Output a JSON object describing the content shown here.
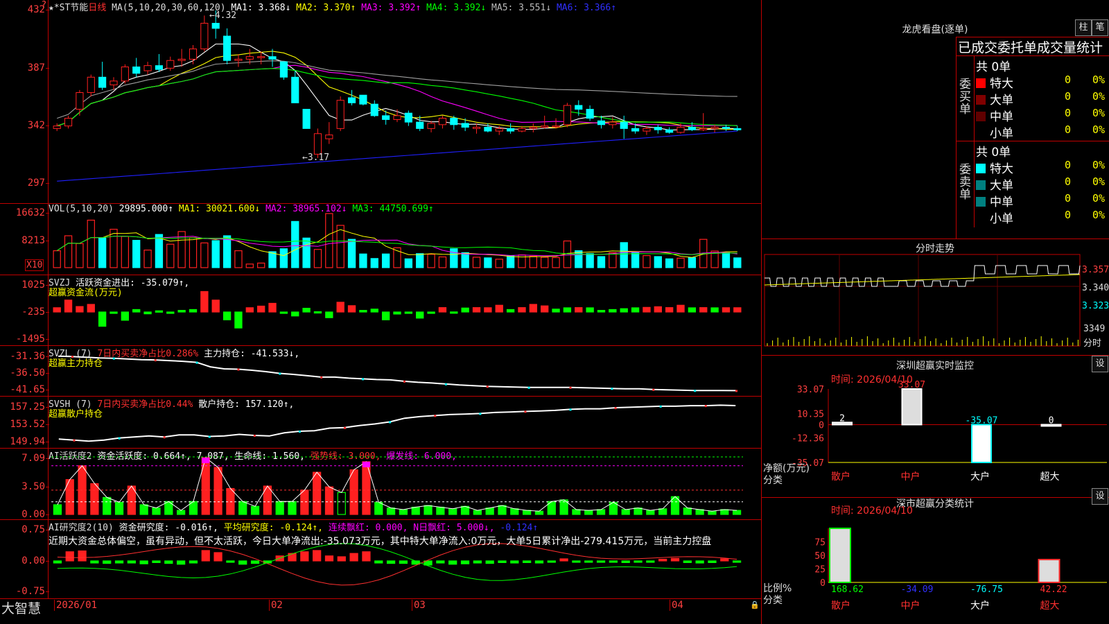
{
  "colors": {
    "up": "#ff2020",
    "down": "#00ffff",
    "bg": "#000000",
    "grid": "#c00000",
    "ma1": "#ffffff",
    "ma2": "#ffff00",
    "ma3": "#ff00ff",
    "ma4": "#00ff00",
    "ma5": "#a0a0a0",
    "ma6": "#2020ff"
  },
  "main": {
    "stock": "★*ST节能",
    "period": "日线",
    "ma_label": "MA(5,10,20,30,60,120)",
    "ma1": "MA1: 3.368↓",
    "ma2": "MA2: 3.370↑",
    "ma3": "MA3: 3.392↑",
    "ma4": "MA4: 3.392↓",
    "ma5": "MA5: 3.551↓",
    "ma6": "MA6: 3.366↑",
    "high_label": "←4.32",
    "low_label": "←3.17",
    "ticks": [
      "432",
      "387",
      "342",
      "297"
    ],
    "corner": "?"
  },
  "vol": {
    "label": "VOL(5,10,20)",
    "value": "29895.000↑",
    "ma1": "MA1: 30021.600↓",
    "ma2": "MA2: 38965.102↓",
    "ma3": "MA3: 44750.699↑",
    "ticks": [
      "16632",
      "8213"
    ],
    "unit": "X10"
  },
  "svzj": {
    "label": "SVZJ",
    "title": "活跃资金进出: -35.079↑,",
    "sub": "超赢资金流(万元)",
    "ticks": [
      "1025",
      "-235",
      "-1495"
    ]
  },
  "svzl": {
    "label": "SVZL (7)",
    "title": "7日内买卖净占比0.286%",
    "value": "主力持仓: -41.533↓,",
    "sub": "超赢主力持仓",
    "ticks": [
      "-31.36",
      "-36.50",
      "-41.65"
    ]
  },
  "svsh": {
    "label": "SVSH (7)",
    "title": "7日内买卖净占比0.44%",
    "value": "散户持仓: 157.120↑,",
    "sub": "超赢散户持仓",
    "ticks": [
      "157.25",
      "153.52",
      "149.94"
    ]
  },
  "ai1": {
    "label": "AI活跃度2",
    "v1": "资金活跃度: 0.664↑, 7.087,",
    "v2": "生命线: 1.560,",
    "v3": "强势线: 3.000,",
    "v4": "爆发线: 6.000,",
    "ticks": [
      "7.09",
      "3.50",
      "0.00"
    ]
  },
  "ai2": {
    "label": "AI研究度2(10)",
    "v1": "资金研究度: -0.016↑,",
    "v2": "平均研究度: -0.124↑,",
    "v3": "连续飘红: 0.000,",
    "v4": "N日飘红: 5.000↓,",
    "v5": "-0.124↑",
    "comment": "近期大资金总体偏空，虽有异动，但不太活跃，今日大单净流出:-35.073万元，其中特大单净流入:0万元，大单5日累计净出-279.415万元，当前主力控盘",
    "ticks": [
      "0.75",
      "0.00",
      "-0.75"
    ]
  },
  "xaxis": {
    "labels": [
      "2026/01",
      "02",
      "03",
      "04"
    ],
    "brand": "大智慧"
  },
  "lhb": {
    "title": "龙虎看盘(逐单)",
    "btn1": "柱",
    "btn2": "笔",
    "subtitle": "已成交委托单成交量统计",
    "buy": {
      "side": "委买单",
      "total": "共 0单",
      "rows": [
        {
          "name": "特大",
          "val": "0",
          "pct": "0%",
          "color": "#ff0000"
        },
        {
          "name": "大单",
          "val": "0",
          "pct": "0%",
          "color": "#800000"
        },
        {
          "name": "中单",
          "val": "0",
          "pct": "0%",
          "color": "#600000"
        },
        {
          "name": "小单",
          "val": "0",
          "pct": "0%",
          "color": "#000000"
        }
      ]
    },
    "sell": {
      "side": "委卖单",
      "total": "共 0单",
      "rows": [
        {
          "name": "特大",
          "val": "0",
          "pct": "0%",
          "color": "#00ffff"
        },
        {
          "name": "大单",
          "val": "0",
          "pct": "0%",
          "color": "#008080"
        },
        {
          "name": "中单",
          "val": "0",
          "pct": "0%",
          "color": "#008080"
        },
        {
          "name": "小单",
          "val": "0",
          "pct": "0%",
          "color": "#000000"
        }
      ]
    }
  },
  "intraday": {
    "title": "分时走势",
    "ticks": [
      "3.357",
      "3.340",
      "3.323"
    ],
    "vol_tick": "3349",
    "vol_unit": "分时"
  },
  "sz_monitor": {
    "title": "深圳超赢实时监控",
    "btn": "设",
    "time": "时间: 2026/04/10",
    "yticks": [
      "33.07",
      "10.35",
      "0",
      "-12.36",
      "-35.07"
    ],
    "ylabel": "净额(万元)",
    "xlabel": "分类",
    "categories": [
      "散户",
      "中户",
      "大户",
      "超大"
    ],
    "values": [
      2,
      33.07,
      -35.07,
      0
    ],
    "value_labels": [
      "2",
      "33.07",
      "-35.07",
      "0"
    ]
  },
  "sz_class": {
    "title": "深市超赢分类统计",
    "btn": "设",
    "time": "时间: 2026/04/10",
    "yticks": [
      "75",
      "50",
      "25",
      "0"
    ],
    "ylabel": "比例%",
    "xlabel": "分类",
    "categories": [
      "散户",
      "中户",
      "大户",
      "超大"
    ],
    "values": [
      168.62,
      -34.09,
      -76.75,
      42.22
    ],
    "value_labels": [
      "168.62",
      "-34.09",
      "-76.75",
      "42.22"
    ]
  },
  "chart_data": [
    {
      "type": "candlestick",
      "title": "★*ST节能 日线",
      "ylim": [
        2.97,
        4.32
      ],
      "high": 4.32,
      "low": 3.17,
      "ohlc": [
        [
          3.4,
          3.44,
          3.38,
          3.42
        ],
        [
          3.42,
          3.5,
          3.4,
          3.48
        ],
        [
          3.55,
          3.7,
          3.5,
          3.68
        ],
        [
          3.68,
          3.82,
          3.65,
          3.8
        ],
        [
          3.8,
          3.92,
          3.7,
          3.72
        ],
        [
          3.74,
          3.8,
          3.7,
          3.77
        ],
        [
          3.77,
          3.9,
          3.75,
          3.88
        ],
        [
          3.88,
          3.95,
          3.8,
          3.83
        ],
        [
          3.85,
          3.92,
          3.82,
          3.89
        ],
        [
          3.89,
          3.98,
          3.84,
          3.86
        ],
        [
          3.87,
          3.96,
          3.85,
          3.93
        ],
        [
          3.93,
          4.02,
          3.88,
          3.94
        ],
        [
          3.94,
          4.05,
          3.9,
          4.02
        ],
        [
          4.02,
          4.28,
          4.0,
          4.22
        ],
        [
          4.22,
          4.32,
          4.1,
          4.18
        ],
        [
          4.12,
          4.18,
          3.9,
          3.93
        ],
        [
          3.93,
          3.98,
          3.88,
          3.94
        ],
        [
          3.94,
          4.02,
          3.9,
          3.96
        ],
        [
          3.96,
          4.0,
          3.9,
          3.96
        ],
        [
          3.96,
          4.02,
          3.88,
          3.94
        ],
        [
          3.92,
          3.92,
          3.78,
          3.8
        ],
        [
          3.8,
          3.85,
          3.6,
          3.6
        ],
        [
          3.55,
          3.55,
          3.4,
          3.4
        ],
        [
          3.2,
          3.4,
          3.17,
          3.36
        ],
        [
          3.32,
          3.45,
          3.28,
          3.35
        ],
        [
          3.4,
          3.65,
          3.38,
          3.62
        ],
        [
          3.64,
          3.7,
          3.58,
          3.6
        ],
        [
          3.66,
          3.66,
          3.58,
          3.59
        ],
        [
          3.59,
          3.62,
          3.49,
          3.5
        ],
        [
          3.5,
          3.54,
          3.43,
          3.47
        ],
        [
          3.47,
          3.55,
          3.45,
          3.5
        ],
        [
          3.52,
          3.54,
          3.42,
          3.45
        ],
        [
          3.45,
          3.5,
          3.38,
          3.4
        ],
        [
          3.4,
          3.46,
          3.37,
          3.44
        ],
        [
          3.43,
          3.5,
          3.4,
          3.48
        ],
        [
          3.48,
          3.5,
          3.39,
          3.43
        ],
        [
          3.44,
          3.48,
          3.38,
          3.41
        ],
        [
          3.4,
          3.44,
          3.36,
          3.41
        ],
        [
          3.41,
          3.44,
          3.37,
          3.38
        ],
        [
          3.38,
          3.42,
          3.35,
          3.4
        ],
        [
          3.4,
          3.44,
          3.36,
          3.38
        ],
        [
          3.38,
          3.42,
          3.37,
          3.4
        ],
        [
          3.4,
          3.44,
          3.37,
          3.41
        ],
        [
          3.41,
          3.5,
          3.4,
          3.42
        ],
        [
          3.42,
          3.48,
          3.4,
          3.42
        ],
        [
          3.43,
          3.6,
          3.41,
          3.58
        ],
        [
          3.58,
          3.62,
          3.5,
          3.55
        ],
        [
          3.55,
          3.58,
          3.46,
          3.48
        ],
        [
          3.46,
          3.5,
          3.4,
          3.43
        ],
        [
          3.43,
          3.49,
          3.4,
          3.45
        ],
        [
          3.45,
          3.5,
          3.32,
          3.4
        ],
        [
          3.4,
          3.44,
          3.36,
          3.38
        ],
        [
          3.38,
          3.42,
          3.35,
          3.4
        ],
        [
          3.41,
          3.43,
          3.36,
          3.39
        ],
        [
          3.39,
          3.41,
          3.36,
          3.37
        ],
        [
          3.37,
          3.44,
          3.36,
          3.41
        ],
        [
          3.41,
          3.45,
          3.38,
          3.39
        ],
        [
          3.39,
          3.52,
          3.38,
          3.4
        ],
        [
          3.4,
          3.43,
          3.37,
          3.41
        ],
        [
          3.41,
          3.43,
          3.38,
          3.4
        ],
        [
          3.4,
          3.42,
          3.38,
          3.39
        ]
      ]
    },
    {
      "type": "bar",
      "title": "VOL(5,10,20)",
      "ylim": [
        0,
        16632
      ],
      "values": [
        5200,
        9800,
        7400,
        14600,
        9100,
        11800,
        9600,
        8400,
        5400,
        10200,
        7200,
        11100,
        9200,
        7600,
        8300,
        9800,
        5200,
        1100,
        1400,
        4900,
        5800,
        14200,
        9100,
        5600,
        16632,
        13000,
        8700,
        4200,
        2800,
        4200,
        6100,
        2700,
        4300,
        4100,
        3300,
        5800,
        4600,
        3200,
        3000,
        2600,
        3700,
        3900,
        3500,
        3200,
        3100,
        8200,
        5200,
        4300,
        3400,
        4600,
        7700,
        4800,
        3700,
        3400,
        2700,
        2900,
        3100,
        8700,
        5100,
        4600,
        3000
      ]
    },
    {
      "type": "bar",
      "title": "SVZJ 活跃资金进出",
      "ylim": [
        -1495,
        1025
      ],
      "values": [
        -35,
        320,
        20,
        120,
        -900,
        -300,
        -620,
        -120,
        -320,
        -180,
        -300,
        -160,
        -120,
        720,
        320,
        -600,
        -980,
        -35,
        40,
        170,
        -300,
        -420,
        -60,
        -220,
        -500,
        220,
        60,
        -160,
        -100,
        -600,
        -330,
        -300,
        -520,
        -300,
        -30,
        -230,
        -50,
        -30,
        -35,
        80,
        -120,
        -30,
        120,
        50,
        -100,
        -40,
        -30,
        -40,
        -160,
        -120,
        -80,
        -40,
        -20,
        10,
        -30,
        80,
        -40,
        -30,
        -40,
        -35,
        -35
      ]
    },
    {
      "type": "line",
      "title": "SVZL 主力持仓",
      "ylim": [
        -41.65,
        -31.36
      ],
      "values": [
        -31.5,
        -31.6,
        -31.8,
        -32.0,
        -32.1,
        -32.3,
        -32.5,
        -32.6,
        -32.8,
        -33.0,
        -33.3,
        -34.6,
        -35.2,
        -35.3,
        -35.6,
        -36.0,
        -36.5,
        -36.8,
        -37.2,
        -37.6,
        -37.6,
        -37.9,
        -38.1,
        -38.3,
        -38.4,
        -38.8,
        -39.1,
        -39.3,
        -39.6,
        -39.9,
        -40.1,
        -40.3,
        -40.4,
        -40.5,
        -40.6,
        -40.6,
        -40.6,
        -40.6,
        -40.7,
        -40.8,
        -40.9,
        -41.0,
        -41.0,
        -41.2,
        -41.3,
        -41.4,
        -41.5,
        -41.5,
        -41.5,
        -41.53
      ]
    },
    {
      "type": "line",
      "title": "SVSH 散户持仓",
      "ylim": [
        149.94,
        157.25
      ],
      "values": [
        150.7,
        150.5,
        150.3,
        150.5,
        150.9,
        151.1,
        151.3,
        151.1,
        151.5,
        151.5,
        151.2,
        151.3,
        151.6,
        151.4,
        151.3,
        151.9,
        152.2,
        152.3,
        152.8,
        152.9,
        153.3,
        153.6,
        154.0,
        154.7,
        155.0,
        155.2,
        155.4,
        155.5,
        155.6,
        155.8,
        155.9,
        156.0,
        156.1,
        156.2,
        156.4,
        156.5,
        156.5,
        156.7,
        156.8,
        156.9,
        157.0,
        157.0,
        157.1,
        157.1,
        157.2,
        157.12
      ]
    },
    {
      "type": "bar",
      "title": "AI活跃度2",
      "ylim": [
        0,
        7.09
      ],
      "values": [
        1.2,
        4.3,
        6.0,
        3.8,
        2.1,
        1.5,
        3.5,
        1.2,
        0.8,
        1.6,
        0.5,
        1.6,
        7.0,
        5.8,
        3.2,
        1.6,
        1.0,
        3.5,
        1.6,
        1.6,
        3.0,
        5.2,
        3.4,
        2.7,
        5.5,
        6.5,
        1.5,
        0.8,
        0.6,
        0.9,
        1.1,
        0.9,
        0.7,
        1.0,
        0.5,
        0.8,
        1.1,
        0.7,
        0.5,
        0.4,
        1.6,
        1.8,
        0.6,
        0.5,
        0.6,
        1.5,
        0.6,
        0.8,
        0.5,
        0.7,
        2.2,
        0.8,
        0.6,
        0.4,
        0.6,
        0.5
      ]
    },
    {
      "type": "bar",
      "title": "AI研究度2(10)",
      "ylim": [
        -0.75,
        0.75
      ],
      "values": [
        -0.05,
        0.22,
        0.24,
        -0.05,
        -0.06,
        -0.05,
        -0.05,
        -0.07,
        -0.04,
        -0.06,
        -0.08,
        -0.05,
        0.25,
        0.2,
        -0.03,
        -0.08,
        -0.06,
        -0.05,
        0.12,
        0.18,
        0.22,
        0.25,
        0.12,
        0.1,
        0.18,
        0.22,
        -0.05,
        -0.06,
        -0.06,
        -0.08,
        -0.1,
        -0.05,
        -0.08,
        -0.07,
        -0.05,
        -0.06,
        -0.04,
        -0.05,
        -0.04,
        -0.05,
        -0.02,
        0.05,
        -0.03,
        -0.02,
        -0.03,
        -0.02,
        -0.04,
        -0.03,
        -0.02,
        0.04,
        0.06,
        -0.04,
        -0.05,
        -0.04,
        0.05,
        -0.016
      ]
    }
  ]
}
